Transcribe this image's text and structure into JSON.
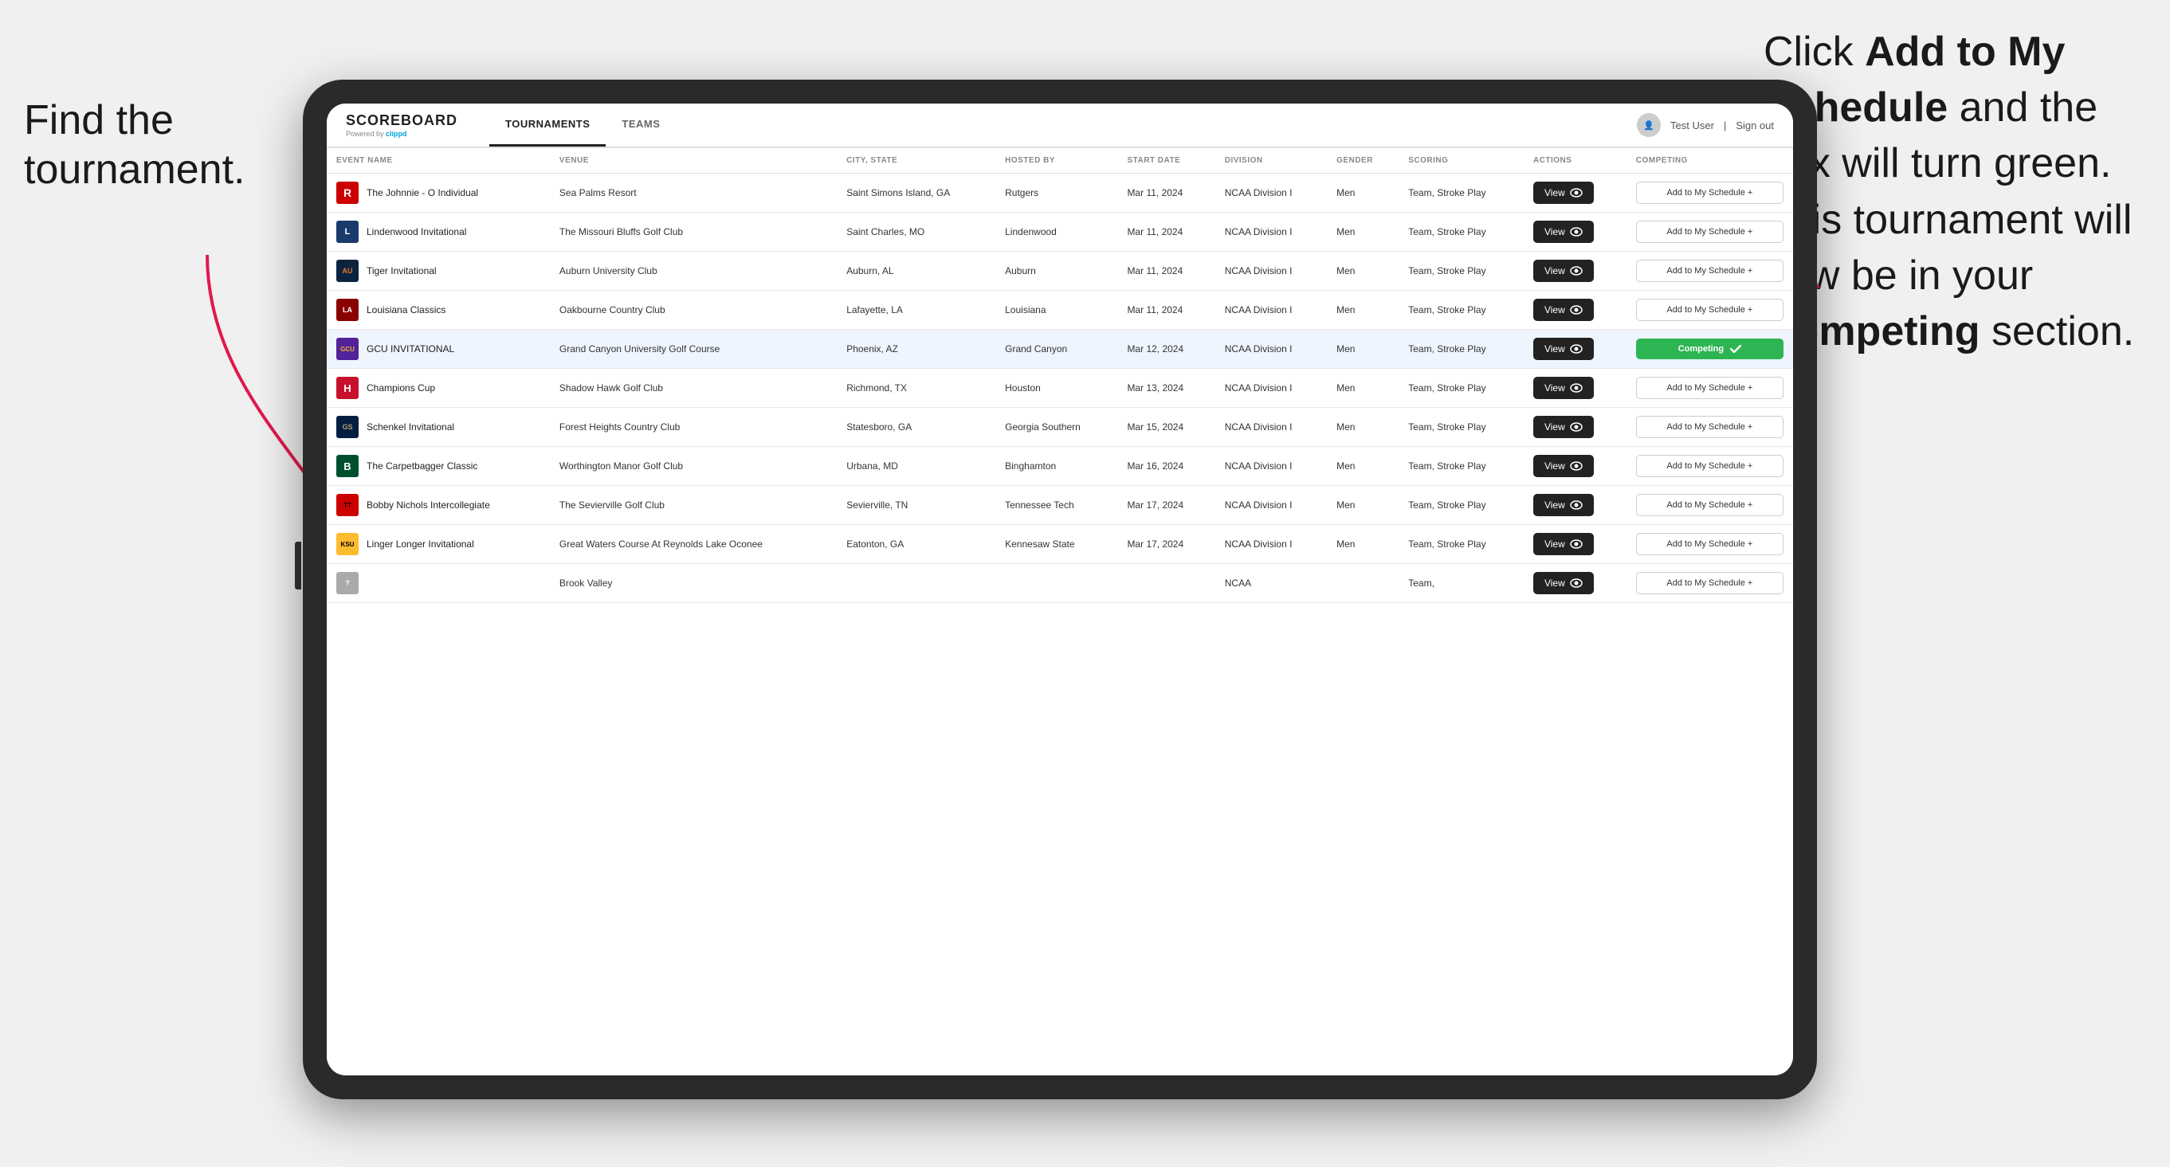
{
  "annotation_left": "Find the\ntournament.",
  "annotation_right_line1": "Click ",
  "annotation_right_bold1": "Add to My\nSchedule",
  "annotation_right_line2": " and the\nbox will turn green.\nThis tournament\nwill now be in\nyour ",
  "annotation_right_bold2": "Competing",
  "annotation_right_line3": "\nsection.",
  "header": {
    "logo_name": "SCOREBOARD",
    "logo_powered": "Powered by",
    "logo_clippd": "clippd",
    "nav_tabs": [
      {
        "label": "TOURNAMENTS",
        "active": true
      },
      {
        "label": "TEAMS",
        "active": false
      }
    ],
    "user_name": "Test User",
    "sign_out": "Sign out"
  },
  "table": {
    "columns": [
      {
        "key": "event_name",
        "label": "EVENT NAME"
      },
      {
        "key": "venue",
        "label": "VENUE"
      },
      {
        "key": "city_state",
        "label": "CITY, STATE"
      },
      {
        "key": "hosted_by",
        "label": "HOSTED BY"
      },
      {
        "key": "start_date",
        "label": "START DATE"
      },
      {
        "key": "division",
        "label": "DIVISION"
      },
      {
        "key": "gender",
        "label": "GENDER"
      },
      {
        "key": "scoring",
        "label": "SCORING"
      },
      {
        "key": "actions",
        "label": "ACTIONS"
      },
      {
        "key": "competing",
        "label": "COMPETING"
      }
    ],
    "rows": [
      {
        "id": 1,
        "logo_class": "logo-r",
        "logo_text": "R",
        "event_name": "The Johnnie - O Individual",
        "venue": "Sea Palms Resort",
        "city_state": "Saint Simons Island, GA",
        "hosted_by": "Rutgers",
        "start_date": "Mar 11, 2024",
        "division": "NCAA Division I",
        "gender": "Men",
        "scoring": "Team, Stroke Play",
        "competing_status": "add",
        "competing_label": "Add to My Schedule +",
        "highlighted": false
      },
      {
        "id": 2,
        "logo_class": "logo-l",
        "logo_text": "L",
        "event_name": "Lindenwood Invitational",
        "venue": "The Missouri Bluffs Golf Club",
        "city_state": "Saint Charles, MO",
        "hosted_by": "Lindenwood",
        "start_date": "Mar 11, 2024",
        "division": "NCAA Division I",
        "gender": "Men",
        "scoring": "Team, Stroke Play",
        "competing_status": "add",
        "competing_label": "Add to My Schedule +",
        "highlighted": false
      },
      {
        "id": 3,
        "logo_class": "logo-au",
        "logo_text": "AU",
        "event_name": "Tiger Invitational",
        "venue": "Auburn University Club",
        "city_state": "Auburn, AL",
        "hosted_by": "Auburn",
        "start_date": "Mar 11, 2024",
        "division": "NCAA Division I",
        "gender": "Men",
        "scoring": "Team, Stroke Play",
        "competing_status": "add",
        "competing_label": "Add to My Schedule +",
        "highlighted": false
      },
      {
        "id": 4,
        "logo_class": "logo-la",
        "logo_text": "LA",
        "event_name": "Louisiana Classics",
        "venue": "Oakbourne Country Club",
        "city_state": "Lafayette, LA",
        "hosted_by": "Louisiana",
        "start_date": "Mar 11, 2024",
        "division": "NCAA Division I",
        "gender": "Men",
        "scoring": "Team, Stroke Play",
        "competing_status": "add",
        "competing_label": "Add to My Schedule +",
        "highlighted": false
      },
      {
        "id": 5,
        "logo_class": "logo-gcu",
        "logo_text": "GCU",
        "event_name": "GCU INVITATIONAL",
        "venue": "Grand Canyon University Golf Course",
        "city_state": "Phoenix, AZ",
        "hosted_by": "Grand Canyon",
        "start_date": "Mar 12, 2024",
        "division": "NCAA Division I",
        "gender": "Men",
        "scoring": "Team, Stroke Play",
        "competing_status": "competing",
        "competing_label": "Competing ✓",
        "highlighted": true
      },
      {
        "id": 6,
        "logo_class": "logo-h",
        "logo_text": "H",
        "event_name": "Champions Cup",
        "venue": "Shadow Hawk Golf Club",
        "city_state": "Richmond, TX",
        "hosted_by": "Houston",
        "start_date": "Mar 13, 2024",
        "division": "NCAA Division I",
        "gender": "Men",
        "scoring": "Team, Stroke Play",
        "competing_status": "add",
        "competing_label": "Add to My Schedule +",
        "highlighted": false
      },
      {
        "id": 7,
        "logo_class": "logo-gs",
        "logo_text": "GS",
        "event_name": "Schenkel Invitational",
        "venue": "Forest Heights Country Club",
        "city_state": "Statesboro, GA",
        "hosted_by": "Georgia Southern",
        "start_date": "Mar 15, 2024",
        "division": "NCAA Division I",
        "gender": "Men",
        "scoring": "Team, Stroke Play",
        "competing_status": "add",
        "competing_label": "Add to My Schedule +",
        "highlighted": false
      },
      {
        "id": 8,
        "logo_class": "logo-b",
        "logo_text": "B",
        "event_name": "The Carpetbagger Classic",
        "venue": "Worthington Manor Golf Club",
        "city_state": "Urbana, MD",
        "hosted_by": "Binghamton",
        "start_date": "Mar 16, 2024",
        "division": "NCAA Division I",
        "gender": "Men",
        "scoring": "Team, Stroke Play",
        "competing_status": "add",
        "competing_label": "Add to My Schedule +",
        "highlighted": false
      },
      {
        "id": 9,
        "logo_class": "logo-tt",
        "logo_text": "TT",
        "event_name": "Bobby Nichols Intercollegiate",
        "venue": "The Sevierville Golf Club",
        "city_state": "Sevierville, TN",
        "hosted_by": "Tennessee Tech",
        "start_date": "Mar 17, 2024",
        "division": "NCAA Division I",
        "gender": "Men",
        "scoring": "Team, Stroke Play",
        "competing_status": "add",
        "competing_label": "Add to My Schedule +",
        "highlighted": false
      },
      {
        "id": 10,
        "logo_class": "logo-k",
        "logo_text": "KSU",
        "event_name": "Linger Longer Invitational",
        "venue": "Great Waters Course At Reynolds Lake Oconee",
        "city_state": "Eatonton, GA",
        "hosted_by": "Kennesaw State",
        "start_date": "Mar 17, 2024",
        "division": "NCAA Division I",
        "gender": "Men",
        "scoring": "Team, Stroke Play",
        "competing_status": "add",
        "competing_label": "Add to My Schedule +",
        "highlighted": false
      },
      {
        "id": 11,
        "logo_class": "logo-unk",
        "logo_text": "?",
        "event_name": "",
        "venue": "Brook Valley",
        "city_state": "",
        "hosted_by": "",
        "start_date": "",
        "division": "NCAA",
        "gender": "",
        "scoring": "Team,",
        "competing_status": "add",
        "competing_label": "Add to My Schedule +",
        "highlighted": false
      }
    ],
    "view_button_label": "View",
    "add_schedule_label": "Add to My Schedule +",
    "competing_label": "Competing ✓"
  }
}
